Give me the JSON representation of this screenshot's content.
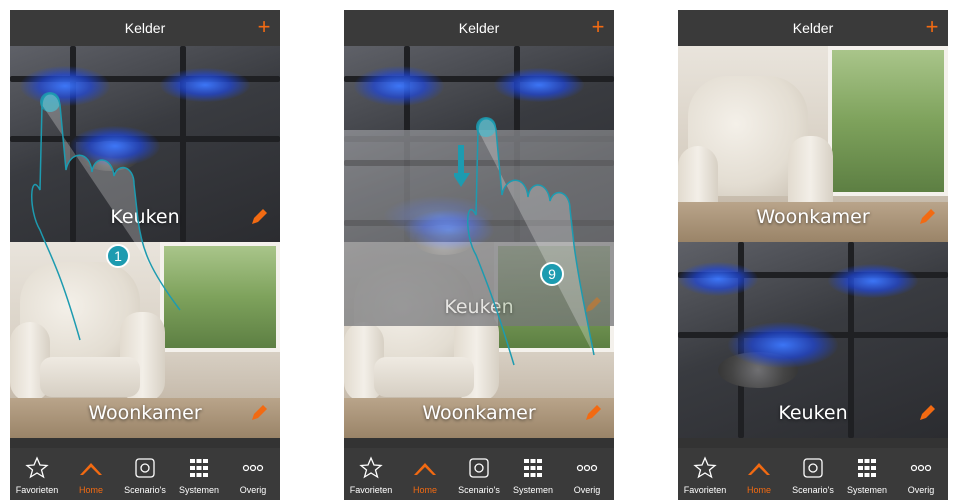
{
  "colors": {
    "accent": "#f26a12",
    "header_bg": "#3a3a3a",
    "badge": "#1d9bb0"
  },
  "phones": [
    {
      "title": "Kelder",
      "rooms": [
        {
          "label": "Keuken",
          "photo": "stove"
        },
        {
          "label": "Woonkamer",
          "photo": "living-room"
        }
      ],
      "step_badge": "1"
    },
    {
      "title": "Kelder",
      "rooms": [
        {
          "label": "Keuken",
          "photo": "stove"
        },
        {
          "label": "Woonkamer",
          "photo": "living-room"
        }
      ],
      "step_badge": "9"
    },
    {
      "title": "Kelder",
      "rooms": [
        {
          "label": "Woonkamer",
          "photo": "living-room"
        },
        {
          "label": "Keuken",
          "photo": "stove"
        }
      ]
    }
  ],
  "header": {
    "add_icon": "plus-icon"
  },
  "tabs": [
    {
      "label": "Favorieten",
      "icon": "star-icon"
    },
    {
      "label": "Home",
      "icon": "home-icon",
      "active": true
    },
    {
      "label": "Scenario's",
      "icon": "scenario-icon"
    },
    {
      "label": "Systemen",
      "icon": "grid-icon"
    },
    {
      "label": "Overig",
      "icon": "more-icon"
    }
  ]
}
